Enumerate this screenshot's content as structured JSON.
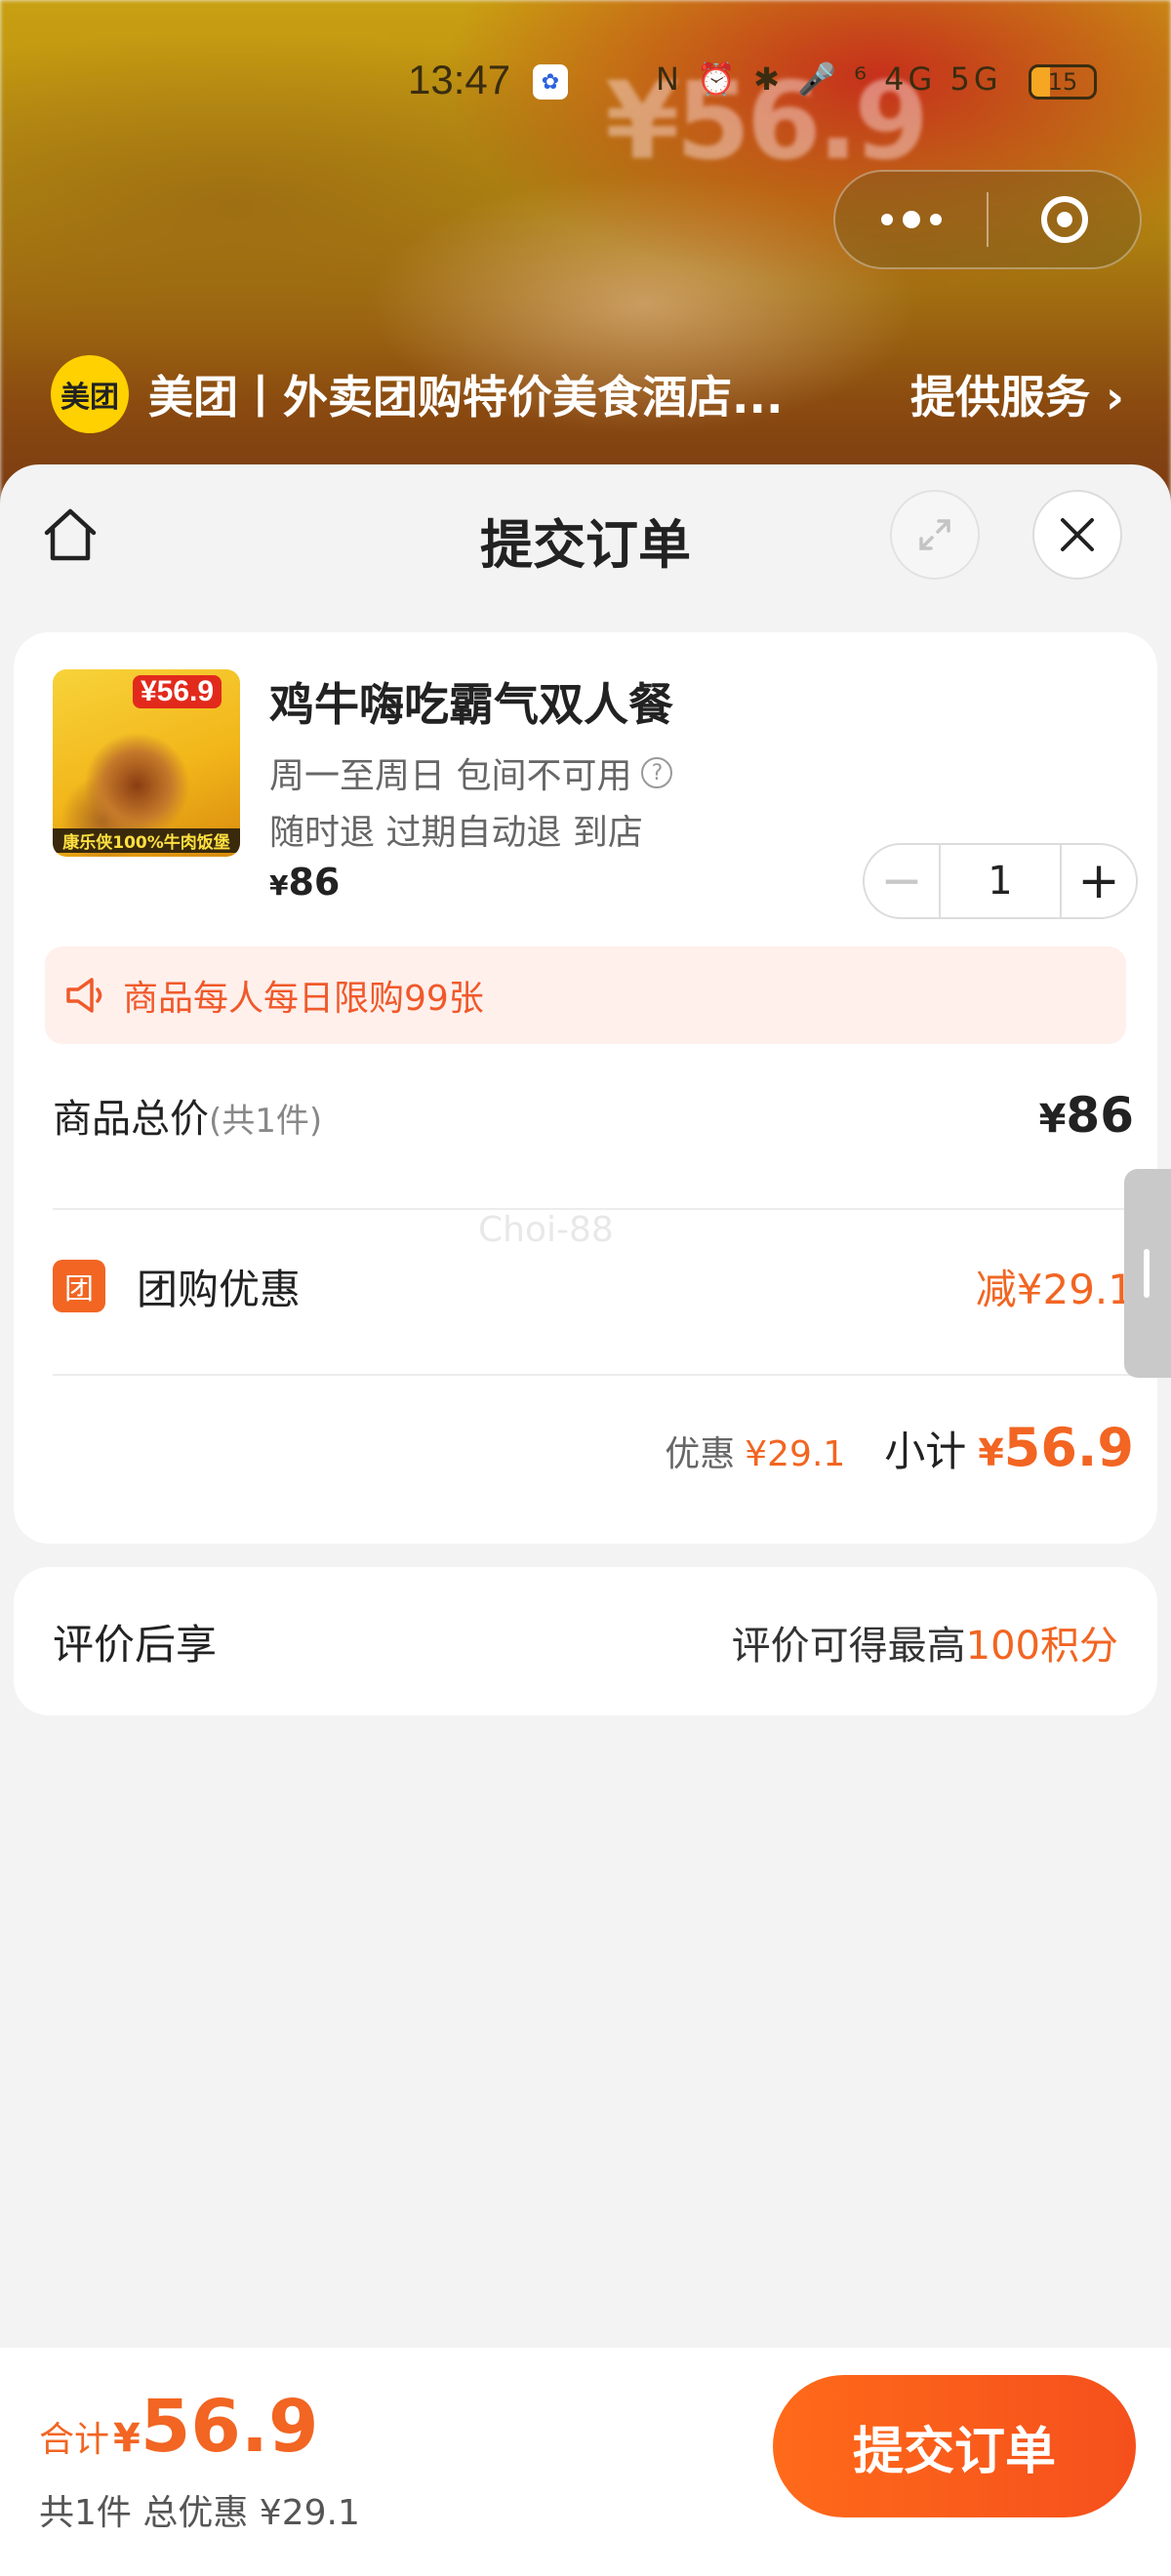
{
  "status_bar": {
    "time": "13:47",
    "battery": "15",
    "signal_icons": "N ⏰ ✱ 🎤 ⁶ 4G 5G"
  },
  "mini_program": {
    "brand_logo_text": "美团",
    "title": "美团丨外卖团购特价美食酒店...",
    "service_link": "提供服务",
    "service_chevron": "›"
  },
  "background": {
    "promo_text": "¥56.9"
  },
  "sheet": {
    "title": "提交订单"
  },
  "product": {
    "image_price_tag": "¥56.9",
    "image_banner": "康乐侠100%牛肉饭堡",
    "name": "鸡牛嗨吃霸气双人餐",
    "availability": "周一至周日 包间不可用",
    "refund_policy": "随时退 过期自动退 到店",
    "price_currency": "¥",
    "price": "86",
    "quantity": "1",
    "minus": "−",
    "plus": "+"
  },
  "limit_notice": "商品每人每日限购99张",
  "summary": {
    "total_label": "商品总价",
    "total_count": "(共1件)",
    "total_currency": "¥",
    "total_value": "86",
    "deal_icon_text": "团",
    "deal_label": "团购优惠",
    "deal_value": "减¥29.1",
    "discount_label": "优惠",
    "discount_value": "¥29.1",
    "subtotal_label": "小计",
    "subtotal_currency": "¥",
    "subtotal_value": "56.9"
  },
  "watermark": "Choi-88",
  "review": {
    "left": "评价后享",
    "right_prefix": "评价可得最高",
    "right_points": "100积分"
  },
  "bottom_bar": {
    "total_label": "合计",
    "total_currency": "¥",
    "total_value": "56.9",
    "sub_text": "共1件 总优惠 ¥29.1",
    "submit_label": "提交订单"
  },
  "colors": {
    "accent": "#f26522",
    "brand_yellow": "#ffd100",
    "notice_bg": "#fff0ec"
  }
}
